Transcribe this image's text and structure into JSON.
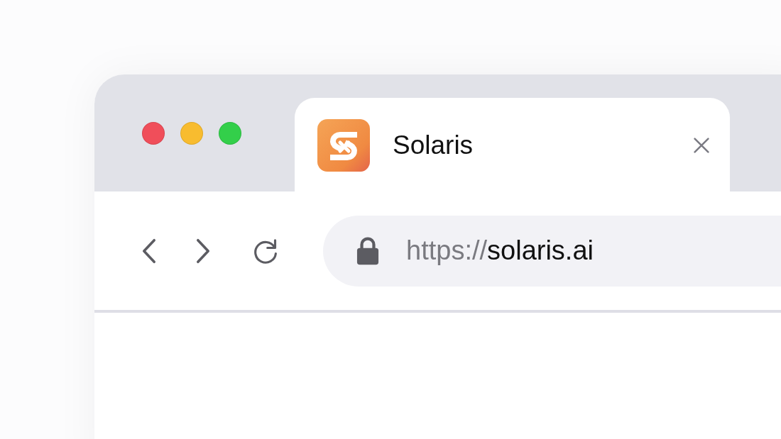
{
  "window_controls": [
    {
      "color": "#f04e5a"
    },
    {
      "color": "#f8bc2f"
    },
    {
      "color": "#33cf4a"
    }
  ],
  "tabs": [
    {
      "title": "Solaris",
      "selected": true
    }
  ],
  "address_bar": {
    "scheme": "https://",
    "host": "solaris.ai"
  }
}
